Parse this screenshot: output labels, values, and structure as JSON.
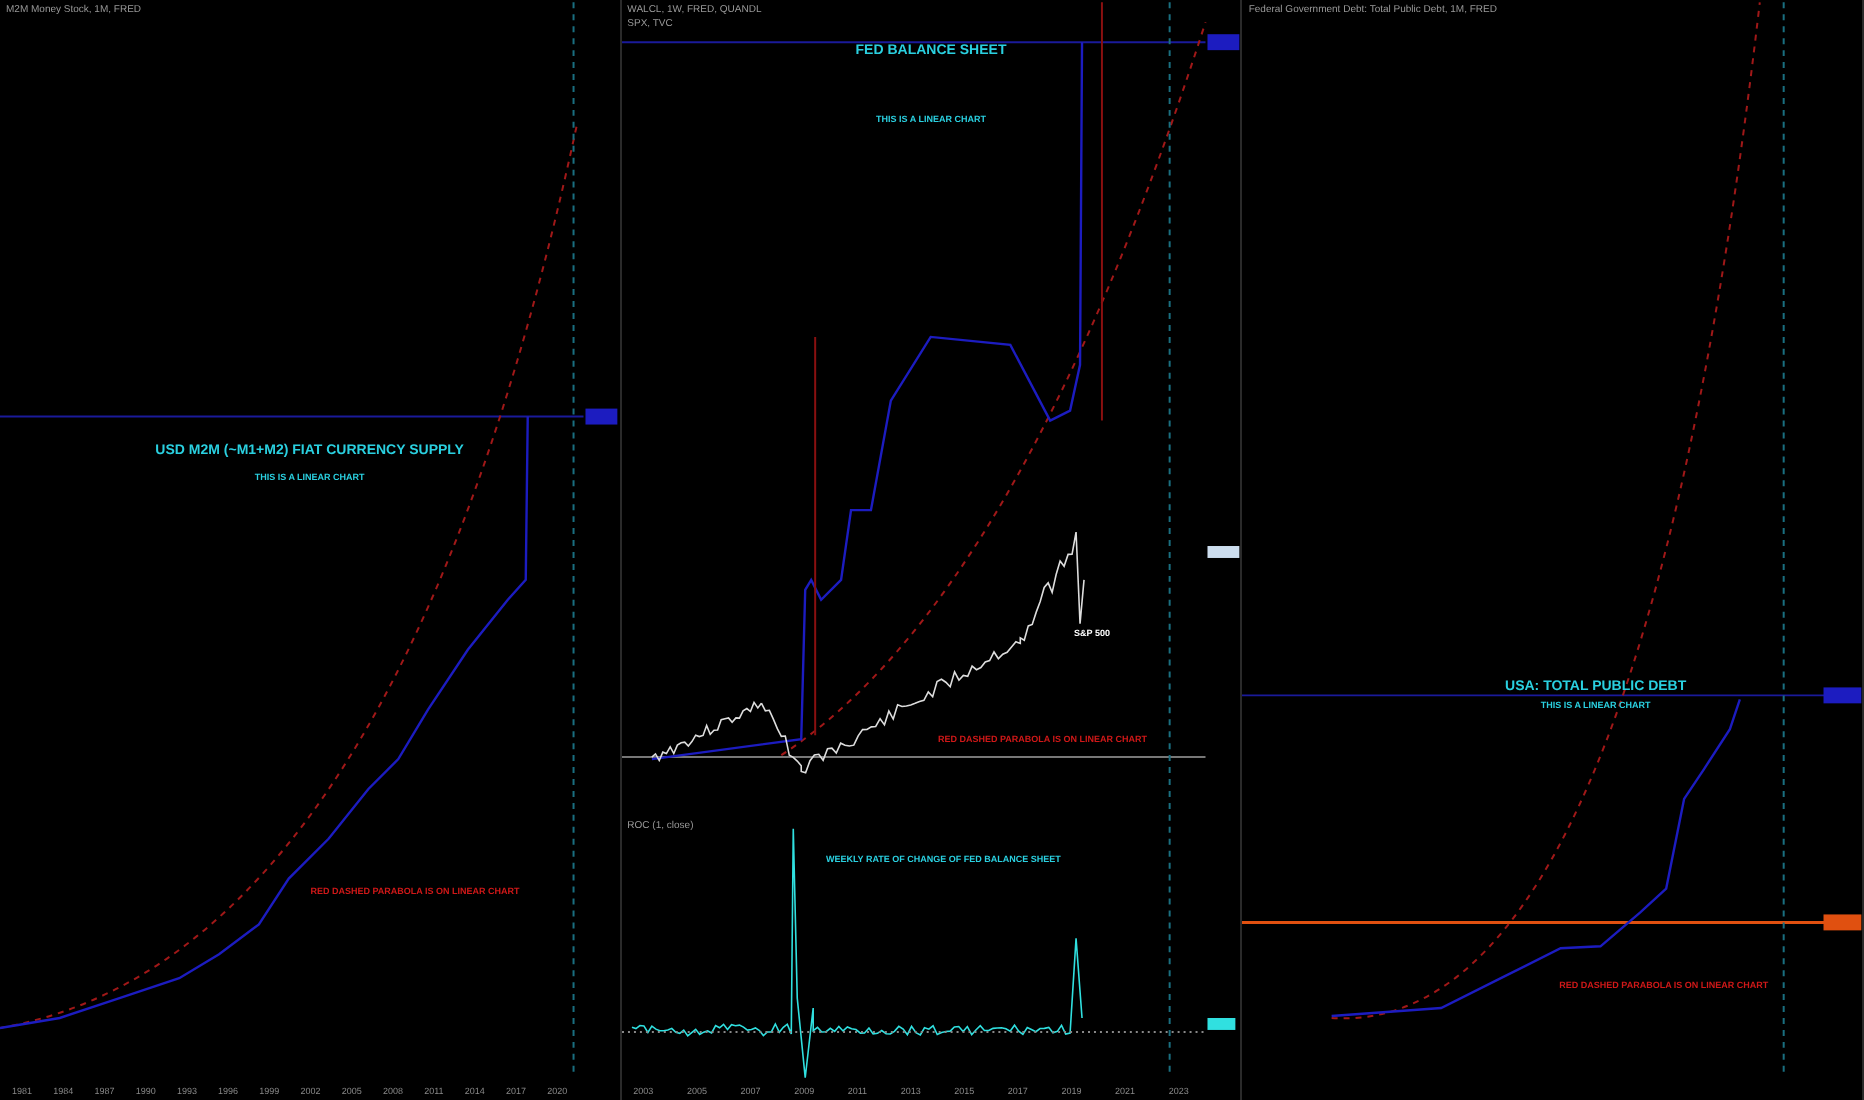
{
  "panes": [
    {
      "legend": [
        "M2M Money Stock, 1M, FRED"
      ],
      "annotations": [
        {
          "kind": "title",
          "text": "USD M2M (~M1+M2) FIAT CURRENCY SUPPLY"
        },
        {
          "kind": "subtitle",
          "text": "THIS IS A LINEAR CHART"
        },
        {
          "kind": "note",
          "text": "RED DASHED PARABOLA IS ON LINEAR CHART"
        }
      ],
      "years": [
        "1981",
        "1984",
        "1987",
        "1990",
        "1993",
        "1996",
        "1999",
        "2002",
        "2005",
        "2008",
        "2011",
        "2014",
        "2017",
        "2020"
      ]
    },
    {
      "legend": [
        "WALCL, 1W, FRED, QUANDL",
        "SPX, TVC"
      ],
      "annotations": [
        {
          "kind": "title",
          "text": "FED BALANCE SHEET"
        },
        {
          "kind": "subtitle",
          "text": "THIS IS A LINEAR CHART"
        },
        {
          "kind": "label",
          "text": "S&P 500"
        },
        {
          "kind": "note",
          "text": "RED DASHED PARABOLA IS ON LINEAR CHART"
        }
      ],
      "indicator": {
        "legend": "ROC (1, close)",
        "annotations": [
          {
            "kind": "subtitle",
            "text": "WEEKLY RATE OF CHANGE OF FED BALANCE SHEET"
          }
        ]
      },
      "years": [
        "2003",
        "2005",
        "2007",
        "2009",
        "2011",
        "2013",
        "2015",
        "2017",
        "2019",
        "2021",
        "2023"
      ]
    },
    {
      "legend": [
        "Federal Government Debt: Total Public Debt, 1M, FRED"
      ],
      "annotations": [
        {
          "kind": "title",
          "text": "USA: TOTAL PUBLIC DEBT"
        },
        {
          "kind": "subtitle",
          "text": "THIS IS A LINEAR CHART"
        },
        {
          "kind": "note",
          "text": "RED DASHED PARABOLA IS ON LINEAR CHART"
        }
      ]
    }
  ]
}
